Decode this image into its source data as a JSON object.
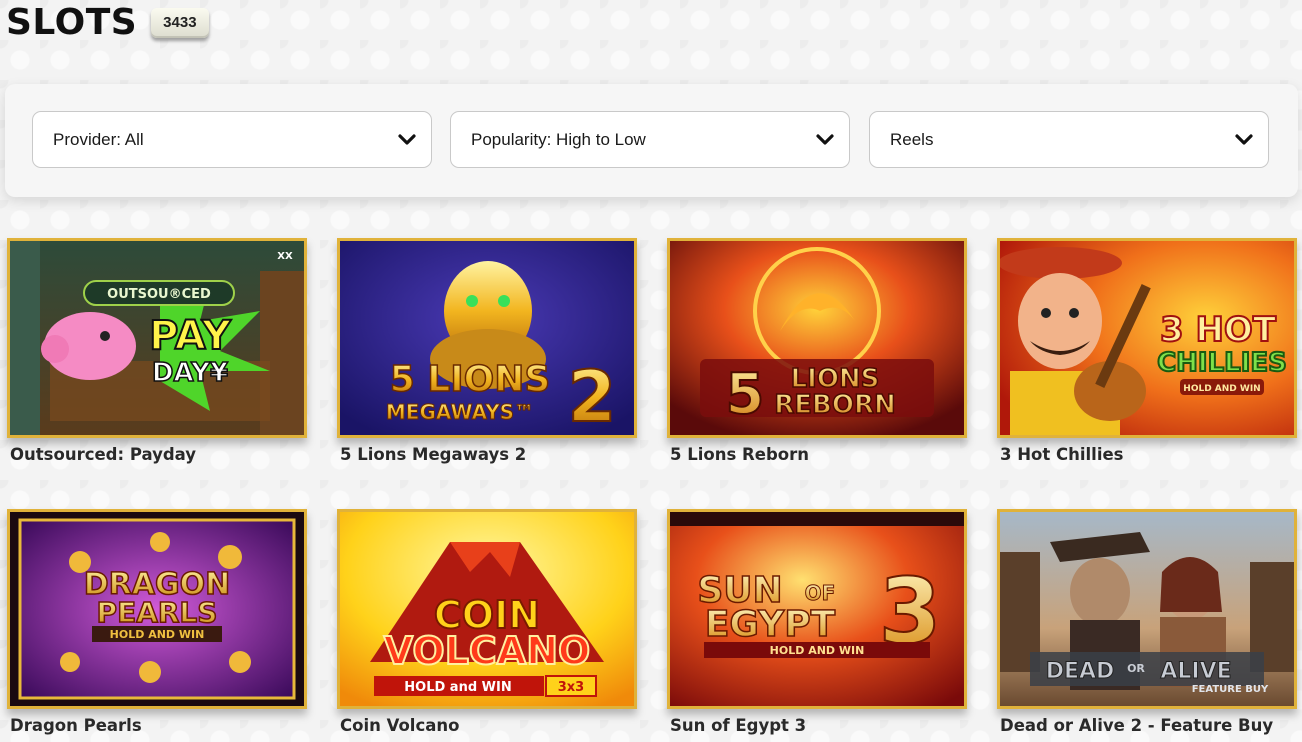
{
  "header": {
    "title": "SLOTS",
    "count": "3433"
  },
  "filters": {
    "provider": "Provider: All",
    "popularity": "Popularity: High to Low",
    "reels": "Reels"
  },
  "games": [
    {
      "name": "Outsourced: Payday",
      "art": {
        "line1": "PAY",
        "line2": "DAY¥",
        "brand": "OUTSOU®CED",
        "corner": "XX"
      }
    },
    {
      "name": "5 Lions Megaways 2",
      "art": {
        "line1": "5 LIONS",
        "line2": "MEGAWAYS™",
        "big": "2"
      }
    },
    {
      "name": "5 Lions Reborn",
      "art": {
        "line1": "LIONS",
        "line2": "REBORN",
        "big": "5"
      }
    },
    {
      "name": "3 Hot Chillies",
      "art": {
        "line1": "3 HOT",
        "line2": "CHILLIES",
        "line3": "HOLD AND WIN"
      }
    },
    {
      "name": "Dragon Pearls",
      "art": {
        "line1": "DRAGON",
        "line2": "PEARLS",
        "line3": "HOLD AND WIN"
      }
    },
    {
      "name": "Coin Volcano",
      "art": {
        "line1": "COIN",
        "line2": "VOLCANO",
        "line3": "HOLD and WIN",
        "badge": "3x3"
      }
    },
    {
      "name": "Sun of Egypt 3",
      "art": {
        "line1": "SUN",
        "line2": "EGYPT",
        "of": "OF",
        "big": "3",
        "line3": "HOLD AND WIN"
      }
    },
    {
      "name": "Dead or Alive 2 - Feature Buy",
      "art": {
        "line1": "DEAD",
        "of": "OR",
        "line2": "ALIVE",
        "line3": "FEATURE BUY"
      }
    }
  ]
}
